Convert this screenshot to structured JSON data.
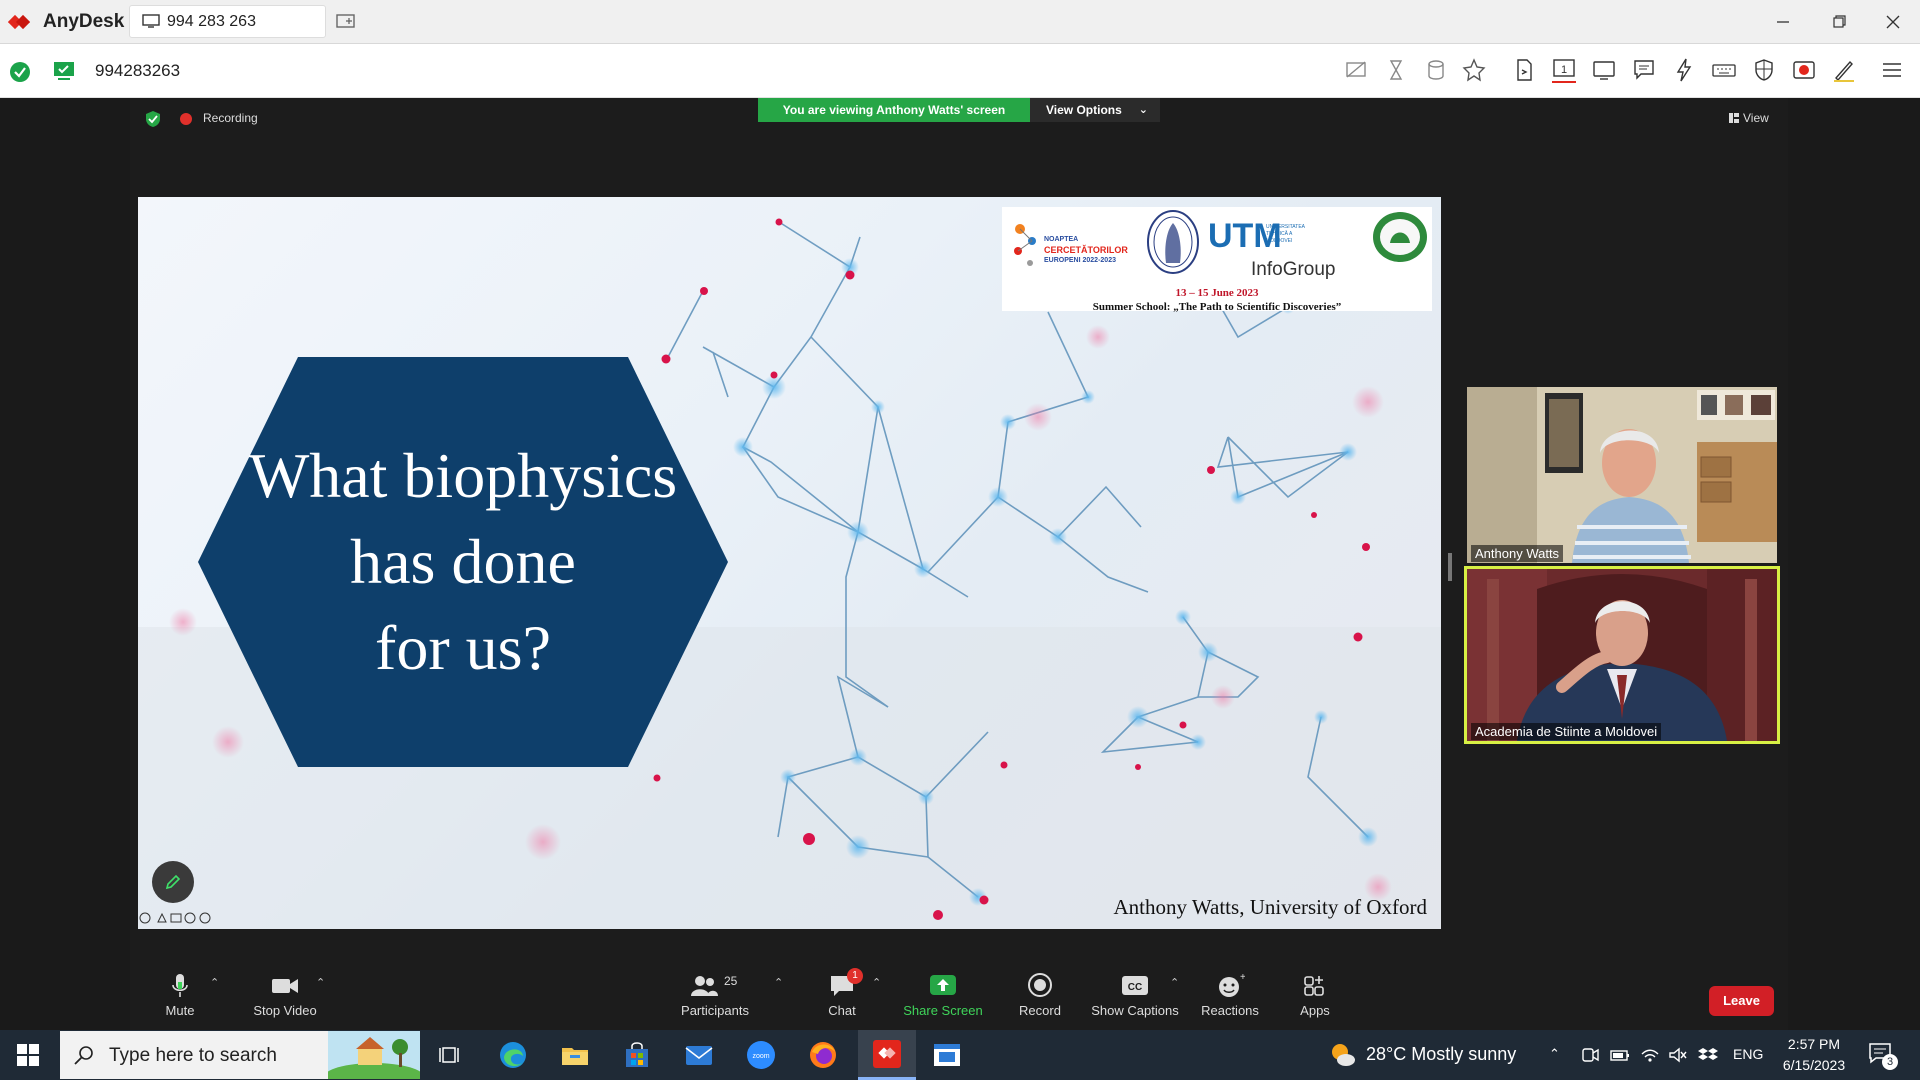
{
  "anydesk": {
    "app_title": "AnyDesk",
    "tab_label": "994 283 263",
    "address_value": "994283263"
  },
  "zoom": {
    "recording_label": "Recording",
    "viewing_banner": "You are viewing Anthony Watts' screen",
    "view_options_label": "View Options",
    "view_label": "View",
    "leave_label": "Leave",
    "participants_count": "25",
    "chat_badge": "1",
    "toolbar": {
      "mute": "Mute",
      "stop_video": "Stop Video",
      "participants": "Participants",
      "chat": "Chat",
      "share_screen": "Share Screen",
      "record": "Record",
      "show_captions": "Show Captions",
      "reactions": "Reactions",
      "apps": "Apps"
    },
    "participants": [
      {
        "name": "Anthony Watts"
      },
      {
        "name": "Academia de Stiinte a Moldovei"
      }
    ]
  },
  "slide": {
    "title_lines": [
      "What biophysics",
      "has done",
      "for us?"
    ],
    "logo_nc_lines": [
      "NOAPTEA",
      "CERCETĂTORILOR",
      "EUROPENI 2022-2023"
    ],
    "logo_utm_caption": "UNIVERSITATEA TEHNICĂ A MOLDOVEI",
    "logo_infogroup": "InfoGroup",
    "dates": "13 – 15 June 2023",
    "school": "Summer School: „The Path to Scientific Discoveries”",
    "credit": "Anthony Watts, University of Oxford"
  },
  "taskbar": {
    "search_placeholder": "Type here to search",
    "weather": "28°C  Mostly sunny",
    "language": "ENG",
    "time": "2:57 PM",
    "date": "6/15/2023",
    "notifications_count": "3"
  },
  "colors": {
    "zoom_green": "#26a646",
    "hexagon_blue": "#0e3f6b",
    "leave_red": "#d21f26",
    "active_speaker_border": "#d8f044",
    "anydesk_red": "#e2261c"
  }
}
